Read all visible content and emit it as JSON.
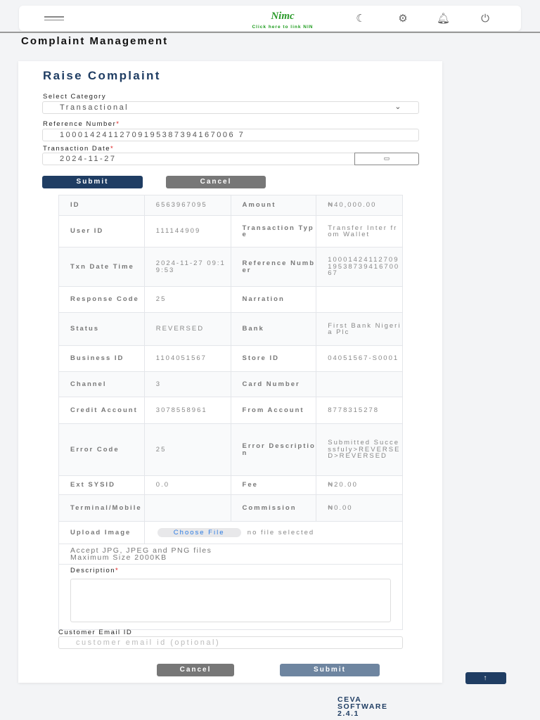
{
  "header": {
    "logo_text": "Nimc",
    "link_nin": "Click here to link NIN"
  },
  "page_title": "Complaint Management",
  "form": {
    "title": "Raise Complaint",
    "category_label": "Select Category",
    "category_value": "Transactional",
    "reference_label": "Reference Number",
    "reference_value": "10001424112709195387394167006 7",
    "date_label": "Transaction Date",
    "date_value": "2024-11-27",
    "submit": "Submit",
    "cancel": "Cancel"
  },
  "details": [
    [
      "ID",
      "6563967095",
      "Amount",
      "₦40,000.00"
    ],
    [
      "User ID",
      "111144909",
      "Transaction Type",
      "Transfer Inter from Wallet"
    ],
    [
      "Txn Date Time",
      "2024-11-27 09:19:53",
      "Reference Number",
      "100014241127091953873941670067"
    ],
    [
      "Response Code",
      "25",
      "Narration",
      ""
    ],
    [
      "Status",
      "REVERSED",
      "Bank",
      "First Bank Nigeria Plc"
    ],
    [
      "Business ID",
      "1104051567",
      "Store ID",
      "04051567-S0001"
    ],
    [
      "Channel",
      "3",
      "Card Number",
      ""
    ],
    [
      "Credit Account",
      "3078558961",
      "From Account",
      "8778315278"
    ],
    [
      "Error Code",
      "25",
      "Error Description",
      "Submitted Successfuly>REVERSED>REVERSED"
    ],
    [
      "Ext SYSID",
      "0.0",
      "Fee",
      "₦20.00"
    ],
    [
      "Terminal/Mobile",
      "",
      "Commission",
      "₦0.00"
    ]
  ],
  "upload": {
    "label": "Upload Image",
    "button": "Choose File",
    "status": "no file selected",
    "hint1": "Accept JPG, JPEG and PNG files",
    "hint2": "Maximum Size 2000KB"
  },
  "description_label": "Description",
  "email": {
    "label": "Customer Email ID",
    "placeholder": "customer email id (optional)"
  },
  "bottom": {
    "cancel": "Cancel",
    "submit": "Submit"
  },
  "footer": {
    "line1": "CEVA",
    "line2": "SOFTWARE",
    "line3": "2.4.1"
  }
}
